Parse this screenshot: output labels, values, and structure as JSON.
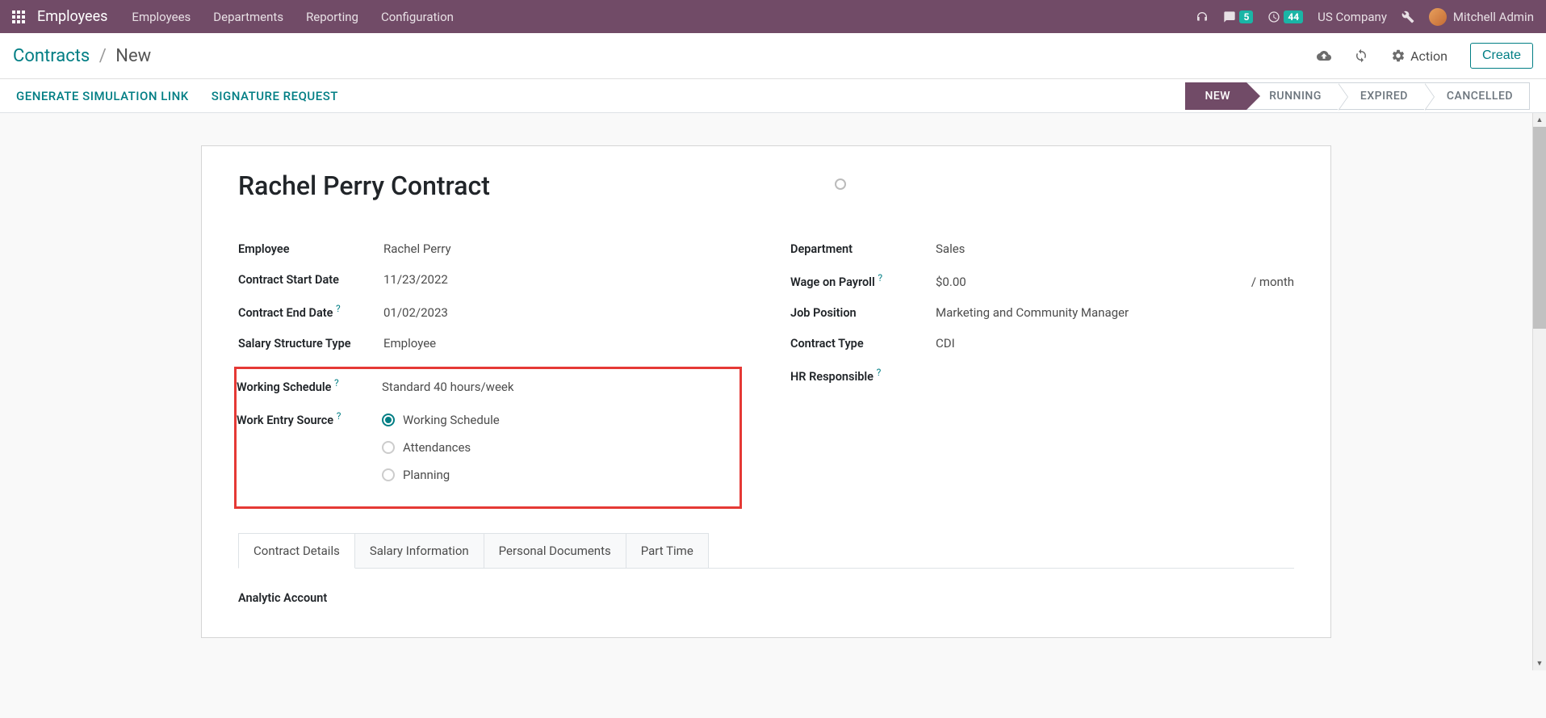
{
  "topbar": {
    "app_name": "Employees",
    "menu": [
      "Employees",
      "Departments",
      "Reporting",
      "Configuration"
    ],
    "chat_badge": "5",
    "activity_badge": "44",
    "company": "US Company",
    "user": "Mitchell Admin"
  },
  "controlbar": {
    "breadcrumb_link": "Contracts",
    "breadcrumb_current": "New",
    "action_label": "Action",
    "create_label": "Create"
  },
  "statusbar": {
    "generate_link": "GENERATE SIMULATION LINK",
    "signature_request": "SIGNATURE REQUEST",
    "states": [
      "NEW",
      "RUNNING",
      "EXPIRED",
      "CANCELLED"
    ],
    "active_state": "NEW"
  },
  "form": {
    "title": "Rachel Perry Contract",
    "left": {
      "employee_label": "Employee",
      "employee_value": "Rachel Perry",
      "start_date_label": "Contract Start Date",
      "start_date_value": "11/23/2022",
      "end_date_label": "Contract End Date",
      "end_date_value": "01/02/2023",
      "salary_type_label": "Salary Structure Type",
      "salary_type_value": "Employee",
      "working_schedule_label": "Working Schedule",
      "working_schedule_value": "Standard 40 hours/week",
      "work_entry_label": "Work Entry Source",
      "work_entry_options": [
        "Working Schedule",
        "Attendances",
        "Planning"
      ],
      "work_entry_selected": "Working Schedule"
    },
    "right": {
      "department_label": "Department",
      "department_value": "Sales",
      "wage_label": "Wage on Payroll",
      "wage_value": "$0.00",
      "wage_suffix": "/ month",
      "job_position_label": "Job Position",
      "job_position_value": "Marketing and Community Manager",
      "contract_type_label": "Contract Type",
      "contract_type_value": "CDI",
      "hr_responsible_label": "HR Responsible",
      "hr_responsible_value": ""
    },
    "tabs": [
      "Contract Details",
      "Salary Information",
      "Personal Documents",
      "Part Time"
    ],
    "active_tab": "Contract Details",
    "analytic_account_label": "Analytic Account"
  }
}
